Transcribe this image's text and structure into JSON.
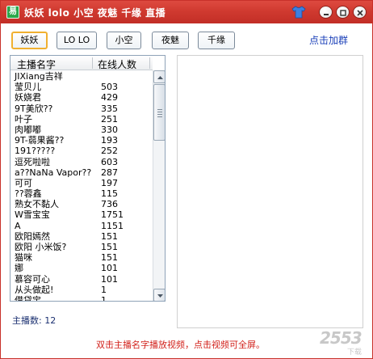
{
  "window": {
    "title": "妖妖 lolo 小空 夜魅 千缘 直播",
    "app_icon": "app-logo-icon",
    "frame_color": "#c8312a"
  },
  "toolbar": {
    "buttons": [
      {
        "label": "妖妖",
        "active": true
      },
      {
        "label": "LO LO",
        "active": false
      },
      {
        "label": "小空",
        "active": false
      },
      {
        "label": "夜魅",
        "active": false
      },
      {
        "label": "千缘",
        "active": false
      }
    ],
    "join_link": "点击加群"
  },
  "list": {
    "headers": {
      "name": "主播名字",
      "online": "在线人数"
    },
    "rows": [
      {
        "name": "JIXiang吉祥",
        "count": ""
      },
      {
        "name": "莹贝儿",
        "count": "503"
      },
      {
        "name": "妖娆君",
        "count": "429"
      },
      {
        "name": "9T美欣??",
        "count": "335"
      },
      {
        "name": "叶子",
        "count": "251"
      },
      {
        "name": "肉嘟嘟",
        "count": "330"
      },
      {
        "name": "9T-蒻果酱??",
        "count": "193"
      },
      {
        "name": "191?????",
        "count": "252"
      },
      {
        "name": "逗死啦啦",
        "count": "603"
      },
      {
        "name": "a??NaNa Vapor??",
        "count": "287"
      },
      {
        "name": "可可",
        "count": "197"
      },
      {
        "name": "??蓉鑫",
        "count": "115"
      },
      {
        "name": "熟女不黏人",
        "count": "736"
      },
      {
        "name": "W雪宝宝",
        "count": "1751"
      },
      {
        "name": "A",
        "count": "1151"
      },
      {
        "name": "欧阳嫣然",
        "count": "151"
      },
      {
        "name": "欧阳   小米饭?",
        "count": "151"
      },
      {
        "name": "猫咪",
        "count": "151"
      },
      {
        "name": "娜",
        "count": "101"
      },
      {
        "name": "慕容可心",
        "count": "101"
      },
      {
        "name": "从头做起!",
        "count": "1"
      },
      {
        "name": "借贷宝",
        "count": "1"
      }
    ]
  },
  "status": {
    "host_count": "主播数: 12",
    "hint": "双击主播名字播放视频，点击视频可全屏。"
  },
  "watermark": {
    "number": "2553",
    "sub": "下载"
  }
}
